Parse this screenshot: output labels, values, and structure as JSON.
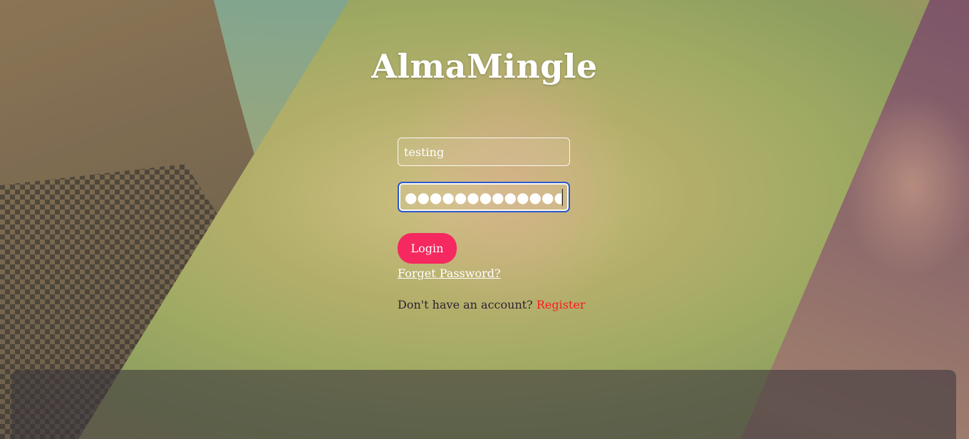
{
  "brand": {
    "title": "AlmaMingle"
  },
  "login_form": {
    "username_value": "testing",
    "password_masked": "●●●●●●●●●●●●●●●●",
    "login_label": "Login",
    "forget_password_label": "Forget Password?",
    "no_account_text": "Don't have an account? ",
    "register_label": "Register"
  },
  "colors": {
    "login_button": "#f5285f",
    "register_link": "#ff1a1a",
    "focus_border": "#2e59c9"
  }
}
